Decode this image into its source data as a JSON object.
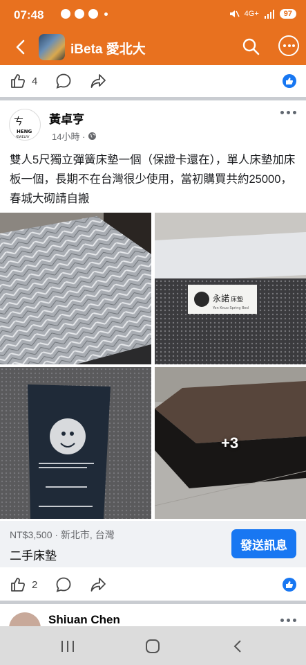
{
  "status_bar": {
    "time": "07:48",
    "network": "4G+",
    "battery": "97"
  },
  "header": {
    "group_name": "iBeta 愛北大"
  },
  "top_actions": {
    "like_count": "4"
  },
  "post": {
    "author": "黃卓亨",
    "time": "14小時 ·",
    "text": "雙人5尺獨立彈簧床墊一個（保證卡還在），單人床墊加床板一個，長期不在台灣很少使用，當初購買共約25000，春城大砌請自搬",
    "more_photos": "+3",
    "listing": {
      "price_location": "NT$3,500 · 新北市, 台灣",
      "item_title": "二手床墊",
      "send_button": "發送訊息"
    },
    "like_count": "2"
  },
  "next_post": {
    "author": "Shiuan Chen"
  },
  "colors": {
    "brand_orange": "#e8711f",
    "facebook_blue": "#1877f2"
  }
}
